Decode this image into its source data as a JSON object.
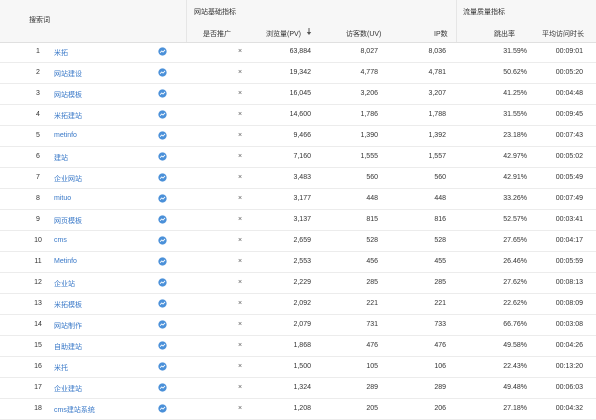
{
  "header": {
    "keyword": "搜索词",
    "group_basic": "网站基础指标",
    "group_quality": "流量质量指标",
    "cols": {
      "promotion": "是否推广",
      "pv": "浏览量(PV)",
      "uv": "访客数(UV)",
      "ip": "IP数",
      "bounce": "跳出率",
      "avg_time": "平均访问时长"
    }
  },
  "rows": [
    {
      "idx": "1",
      "keyword": "米拓",
      "promotion": "×",
      "pv": "63,884",
      "uv": "8,027",
      "ip": "8,036",
      "bounce": "31.59%",
      "avg_time": "00:09:01"
    },
    {
      "idx": "2",
      "keyword": "网站建设",
      "promotion": "×",
      "pv": "19,342",
      "uv": "4,778",
      "ip": "4,781",
      "bounce": "50.62%",
      "avg_time": "00:05:20"
    },
    {
      "idx": "3",
      "keyword": "网站模板",
      "promotion": "×",
      "pv": "16,045",
      "uv": "3,206",
      "ip": "3,207",
      "bounce": "41.25%",
      "avg_time": "00:04:48"
    },
    {
      "idx": "4",
      "keyword": "米拓建站",
      "promotion": "×",
      "pv": "14,600",
      "uv": "1,786",
      "ip": "1,788",
      "bounce": "31.55%",
      "avg_time": "00:09:45"
    },
    {
      "idx": "5",
      "keyword": "metinfo",
      "promotion": "×",
      "pv": "9,466",
      "uv": "1,390",
      "ip": "1,392",
      "bounce": "23.18%",
      "avg_time": "00:07:43"
    },
    {
      "idx": "6",
      "keyword": "建站",
      "promotion": "×",
      "pv": "7,160",
      "uv": "1,555",
      "ip": "1,557",
      "bounce": "42.97%",
      "avg_time": "00:05:02"
    },
    {
      "idx": "7",
      "keyword": "企业网站",
      "promotion": "×",
      "pv": "3,483",
      "uv": "560",
      "ip": "560",
      "bounce": "42.91%",
      "avg_time": "00:05:49"
    },
    {
      "idx": "8",
      "keyword": "mituo",
      "promotion": "×",
      "pv": "3,177",
      "uv": "448",
      "ip": "448",
      "bounce": "33.26%",
      "avg_time": "00:07:49"
    },
    {
      "idx": "9",
      "keyword": "网页模板",
      "promotion": "×",
      "pv": "3,137",
      "uv": "815",
      "ip": "816",
      "bounce": "52.57%",
      "avg_time": "00:03:41"
    },
    {
      "idx": "10",
      "keyword": "cms",
      "promotion": "×",
      "pv": "2,659",
      "uv": "528",
      "ip": "528",
      "bounce": "27.65%",
      "avg_time": "00:04:17"
    },
    {
      "idx": "11",
      "keyword": "Metinfo",
      "promotion": "×",
      "pv": "2,553",
      "uv": "456",
      "ip": "455",
      "bounce": "26.46%",
      "avg_time": "00:05:59"
    },
    {
      "idx": "12",
      "keyword": "企业站",
      "promotion": "×",
      "pv": "2,229",
      "uv": "285",
      "ip": "285",
      "bounce": "27.62%",
      "avg_time": "00:08:13"
    },
    {
      "idx": "13",
      "keyword": "米拓模板",
      "promotion": "×",
      "pv": "2,092",
      "uv": "221",
      "ip": "221",
      "bounce": "22.62%",
      "avg_time": "00:08:09"
    },
    {
      "idx": "14",
      "keyword": "网站制作",
      "promotion": "×",
      "pv": "2,079",
      "uv": "731",
      "ip": "733",
      "bounce": "66.76%",
      "avg_time": "00:03:08"
    },
    {
      "idx": "15",
      "keyword": "自助建站",
      "promotion": "×",
      "pv": "1,868",
      "uv": "476",
      "ip": "476",
      "bounce": "49.58%",
      "avg_time": "00:04:26"
    },
    {
      "idx": "16",
      "keyword": "米托",
      "promotion": "×",
      "pv": "1,500",
      "uv": "105",
      "ip": "106",
      "bounce": "22.43%",
      "avg_time": "00:13:20"
    },
    {
      "idx": "17",
      "keyword": "企业建站",
      "promotion": "×",
      "pv": "1,324",
      "uv": "289",
      "ip": "289",
      "bounce": "49.48%",
      "avg_time": "00:06:03"
    },
    {
      "idx": "18",
      "keyword": "cms建站系统",
      "promotion": "×",
      "pv": "1,208",
      "uv": "205",
      "ip": "206",
      "bounce": "27.18%",
      "avg_time": "00:04:32"
    }
  ],
  "colors": {
    "link": "#3878c8",
    "header_bg": "#f7f7f7",
    "icon": "#4a90d9"
  }
}
